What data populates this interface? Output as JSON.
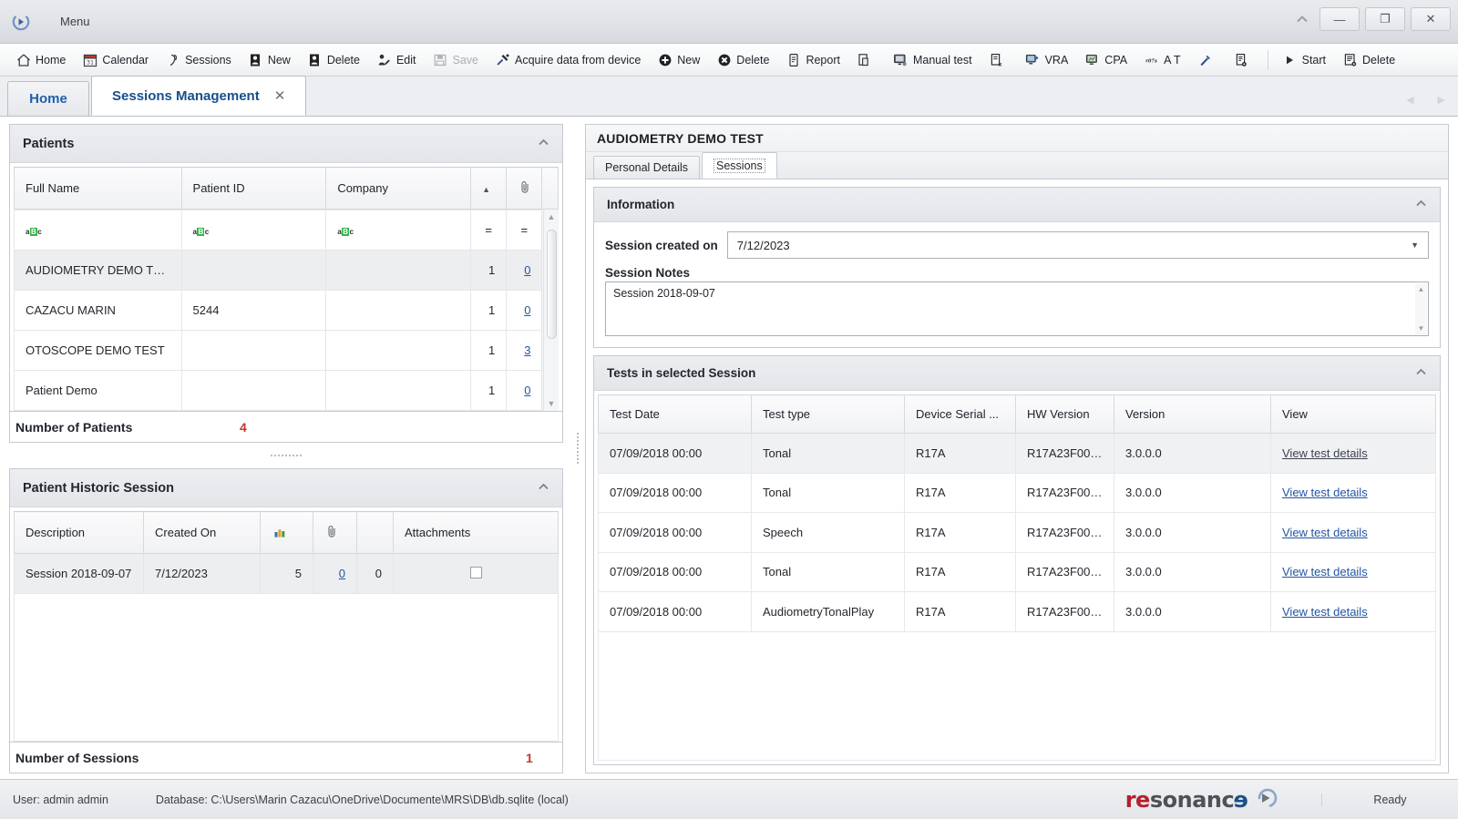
{
  "window": {
    "menu_label": "Menu",
    "app_icon": "resonance-orb-icon",
    "controls": {
      "chevron": "chevron-up-icon",
      "minimize": "—",
      "restore": "❐",
      "close": "✕"
    }
  },
  "toolbar": {
    "items": [
      {
        "label": "Home",
        "icon": "home-icon",
        "disabled": false
      },
      {
        "label": "Calendar",
        "icon": "calendar-icon",
        "disabled": false
      },
      {
        "label": "Sessions",
        "icon": "sessions-icon",
        "disabled": false
      },
      {
        "label": "New",
        "icon": "new-patient-icon",
        "disabled": false
      },
      {
        "label": "Delete",
        "icon": "delete-patient-icon",
        "disabled": false
      },
      {
        "label": "Edit",
        "icon": "edit-patient-icon",
        "disabled": false
      },
      {
        "label": "Save",
        "icon": "save-icon",
        "disabled": true
      },
      {
        "label": "Acquire data from device",
        "icon": "acquire-device-icon",
        "disabled": false
      },
      {
        "label": "New",
        "icon": "add-circle-icon",
        "disabled": false
      },
      {
        "label": "Delete",
        "icon": "delete-circle-icon",
        "disabled": false
      },
      {
        "label": "Report",
        "icon": "report-icon",
        "disabled": false
      },
      {
        "label": "",
        "icon": "document-copy-icon",
        "disabled": false
      },
      {
        "label": "Manual test",
        "icon": "manual-test-icon",
        "disabled": false
      },
      {
        "label": "",
        "icon": "document-excel-icon",
        "disabled": false
      },
      {
        "label": "VRA",
        "icon": "vra-icon",
        "disabled": false
      },
      {
        "label": "CPA",
        "icon": "cpa-icon",
        "disabled": false
      },
      {
        "label": "A T",
        "icon": "r07s-icon",
        "disabled": false
      },
      {
        "label": "",
        "icon": "tuning-fork-icon",
        "disabled": false
      },
      {
        "label": "",
        "icon": "document-settings-icon",
        "disabled": false
      }
    ],
    "right_items": [
      {
        "label": "Start",
        "icon": "play-icon"
      },
      {
        "label": "Delete",
        "icon": "delete-list-icon"
      }
    ]
  },
  "tabs": {
    "items": [
      {
        "label": "Home",
        "active": false,
        "closable": false
      },
      {
        "label": "Sessions Management",
        "active": true,
        "closable": true,
        "close": "✕"
      }
    ],
    "nav_prev": "◀",
    "nav_next": "▶"
  },
  "patients_panel": {
    "title": "Patients",
    "collapse_icon": "chevron-up-icon",
    "columns": [
      "Full Name",
      "Patient ID",
      "Company",
      "▲",
      "paperclip-icon"
    ],
    "filter_row": {
      "text_filter": "aBc",
      "op": "="
    },
    "rows": [
      {
        "full_name": "AUDIOMETRY DEMO TE...",
        "patient_id": "",
        "company": "",
        "sessions": "1",
        "attachments": "0",
        "selected": true
      },
      {
        "full_name": "CAZACU MARIN",
        "patient_id": "5244",
        "company": "",
        "sessions": "1",
        "attachments": "0",
        "selected": false
      },
      {
        "full_name": "OTOSCOPE DEMO TEST",
        "patient_id": "",
        "company": "",
        "sessions": "1",
        "attachments": "3",
        "selected": false
      },
      {
        "full_name": "Patient Demo",
        "patient_id": "",
        "company": "",
        "sessions": "1",
        "attachments": "0",
        "selected": false
      }
    ],
    "count_label": "Number of Patients",
    "count_value": "4"
  },
  "historic_panel": {
    "title": "Patient Historic Session",
    "collapse_icon": "chevron-up-icon",
    "columns": [
      "Description",
      "Created On",
      "chart-icon",
      "paperclip-icon",
      "",
      "Attachments"
    ],
    "rows": [
      {
        "description": "Session 2018-09-07",
        "created_on": "7/12/2023",
        "tests": "5",
        "attachments": "0",
        "extra": "0",
        "checkbox": "☐",
        "selected": true
      }
    ],
    "count_label": "Number of Sessions",
    "count_value": "1"
  },
  "detail": {
    "title": "AUDIOMETRY DEMO TEST",
    "subtabs": [
      {
        "label": "Personal Details",
        "active": false
      },
      {
        "label": "Sessions",
        "active": true
      }
    ],
    "information": {
      "title": "Information",
      "collapse_icon": "chevron-up-icon",
      "session_created_label": "Session created on",
      "session_created_value": "7/12/2023",
      "dropdown_icon": "chevron-down-icon",
      "notes_label": "Session Notes",
      "notes_value": "Session 2018-09-07"
    },
    "tests": {
      "title": "Tests in selected Session",
      "collapse_icon": "chevron-up-icon",
      "columns": [
        "Test Date",
        "Test type",
        "Device Serial ...",
        "HW Version",
        "Version",
        "View"
      ],
      "rows": [
        {
          "date": "07/09/2018 00:00",
          "type": "Tonal",
          "serial": "R17A",
          "hw": "R17A23F0020...",
          "version": "3.0.0.0",
          "view": "View test details",
          "selected": true
        },
        {
          "date": "07/09/2018 00:00",
          "type": "Tonal",
          "serial": "R17A",
          "hw": "R17A23F0020...",
          "version": "3.0.0.0",
          "view": "View test details",
          "selected": false
        },
        {
          "date": "07/09/2018 00:00",
          "type": "Speech",
          "serial": "R17A",
          "hw": "R17A23F0020...",
          "version": "3.0.0.0",
          "view": "View test details",
          "selected": false
        },
        {
          "date": "07/09/2018 00:00",
          "type": "Tonal",
          "serial": "R17A",
          "hw": "R17A23F0020...",
          "version": "3.0.0.0",
          "view": "View test details",
          "selected": false
        },
        {
          "date": "07/09/2018 00:00",
          "type": "AudiometryTonalPlay",
          "serial": "R17A",
          "hw": "R17A23F0020...",
          "version": "3.0.0.0",
          "view": "View test details",
          "selected": false
        }
      ]
    }
  },
  "statusbar": {
    "user": "User: admin admin",
    "database": "Database: C:\\Users\\Marin Cazacu\\OneDrive\\Documente\\MRS\\DB\\db.sqlite (local)",
    "logo": {
      "part1": "re",
      "part2": "sonanc",
      "part3": "e",
      "mark": "resonance-mark-icon"
    },
    "ready": "Ready"
  }
}
